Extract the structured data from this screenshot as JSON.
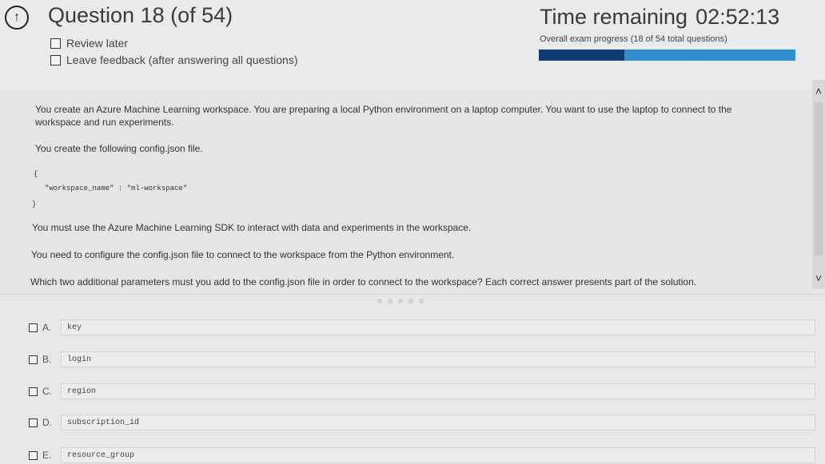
{
  "header": {
    "question_title": "Question 18 (of 54)",
    "review_later": "Review later",
    "leave_feedback": "Leave feedback (after answering all questions)",
    "time_label": "Time remaining",
    "time_value": "02:52:13",
    "progress_label": "Overall exam progress (18 of 54 total questions)",
    "progress_fraction": 0.333,
    "progress_color": "#123a73",
    "progress_track_color": "#2f8fd0"
  },
  "question": {
    "para1": "You create an Azure Machine Learning workspace. You are preparing a local Python environment on a laptop computer. You want to use the laptop to connect to the workspace and run experiments.",
    "para2": "You create the following config.json file.",
    "code_open": "{",
    "code_line": "\"workspace_name\" : \"ml-workspace\"",
    "code_close": "}",
    "para3": "You must use the Azure Machine Learning SDK to interact with data and experiments in the workspace.",
    "para4": "You need to configure the config.json file to connect to the workspace from the Python environment.",
    "para5": "Which two additional parameters must you add to the config.json file in order to connect to the workspace? Each correct answer presents part of the solution."
  },
  "answers": [
    {
      "letter": "A.",
      "text": "key"
    },
    {
      "letter": "B.",
      "text": "login"
    },
    {
      "letter": "C.",
      "text": "region"
    },
    {
      "letter": "D.",
      "text": "subscription_id"
    },
    {
      "letter": "E.",
      "text": "resource_group"
    }
  ],
  "icons": {
    "back": "back-arrow-icon",
    "scroll_up": "chevron-up-icon",
    "scroll_down": "chevron-down-icon"
  }
}
